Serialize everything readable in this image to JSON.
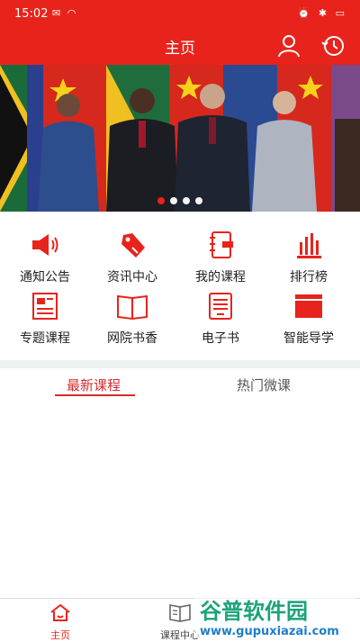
{
  "status": {
    "time": "15:02"
  },
  "header": {
    "title": "主页"
  },
  "menu": [
    {
      "label": "通知公告",
      "icon": "megaphone-icon"
    },
    {
      "label": "资讯中心",
      "icon": "tag-icon"
    },
    {
      "label": "我的课程",
      "icon": "notebook-icon"
    },
    {
      "label": "排行榜",
      "icon": "bar-chart-icon"
    },
    {
      "label": "专题课程",
      "icon": "newspaper-icon"
    },
    {
      "label": "网院书香",
      "icon": "open-book-icon"
    },
    {
      "label": "电子书",
      "icon": "ebook-icon"
    },
    {
      "label": "智能导学",
      "icon": "folder-icon"
    }
  ],
  "tabs": [
    {
      "label": "最新课程",
      "active": true
    },
    {
      "label": "热门微课",
      "active": false
    }
  ],
  "bottom_nav": [
    {
      "label": "主页",
      "icon": "home-icon",
      "active": true
    },
    {
      "label": "课程中心",
      "icon": "book-icon",
      "active": false
    }
  ],
  "colors": {
    "accent": "#e8231b",
    "tab_active": "#d52c2c"
  },
  "watermark": {
    "title": "谷普软件园",
    "url": "www.gupuxiazai.com"
  }
}
